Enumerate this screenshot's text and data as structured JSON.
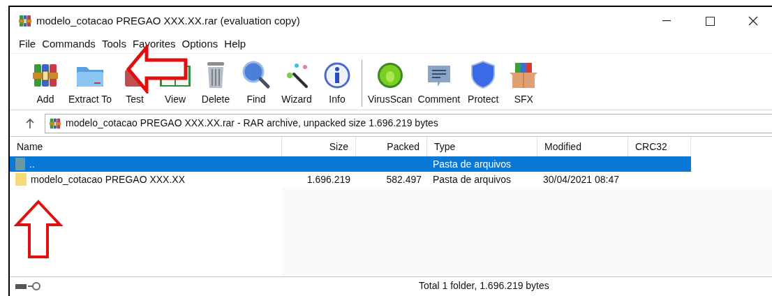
{
  "window": {
    "title": "modelo_cotacao PREGAO XXX.XX.rar (evaluation copy)"
  },
  "menu": [
    "File",
    "Commands",
    "Tools",
    "Favorites",
    "Options",
    "Help"
  ],
  "toolbar_groups": [
    [
      "Add",
      "Extract To",
      "Test",
      "View",
      "Delete",
      "Find",
      "Wizard",
      "Info"
    ],
    [
      "VirusScan",
      "Comment",
      "Protect",
      "SFX"
    ]
  ],
  "address": {
    "text": "modelo_cotacao PREGAO XXX.XX.rar - RAR archive, unpacked size 1.696.219 bytes"
  },
  "table": {
    "columns": [
      "Name",
      "Size",
      "Packed",
      "Type",
      "Modified",
      "CRC32"
    ],
    "rows": [
      {
        "kind": "parent",
        "selected": true,
        "cells": [
          "..",
          "",
          "",
          "Pasta de arquivos",
          "",
          ""
        ]
      },
      {
        "kind": "folder",
        "selected": false,
        "cells": [
          "modelo_cotacao PREGAO XXX.XX",
          "1.696.219",
          "582.497",
          "Pasta de arquivos",
          "30/04/2021 08:47",
          ""
        ]
      }
    ]
  },
  "status_bar": {
    "text": "Total 1 folder, 1.696.219 bytes"
  }
}
